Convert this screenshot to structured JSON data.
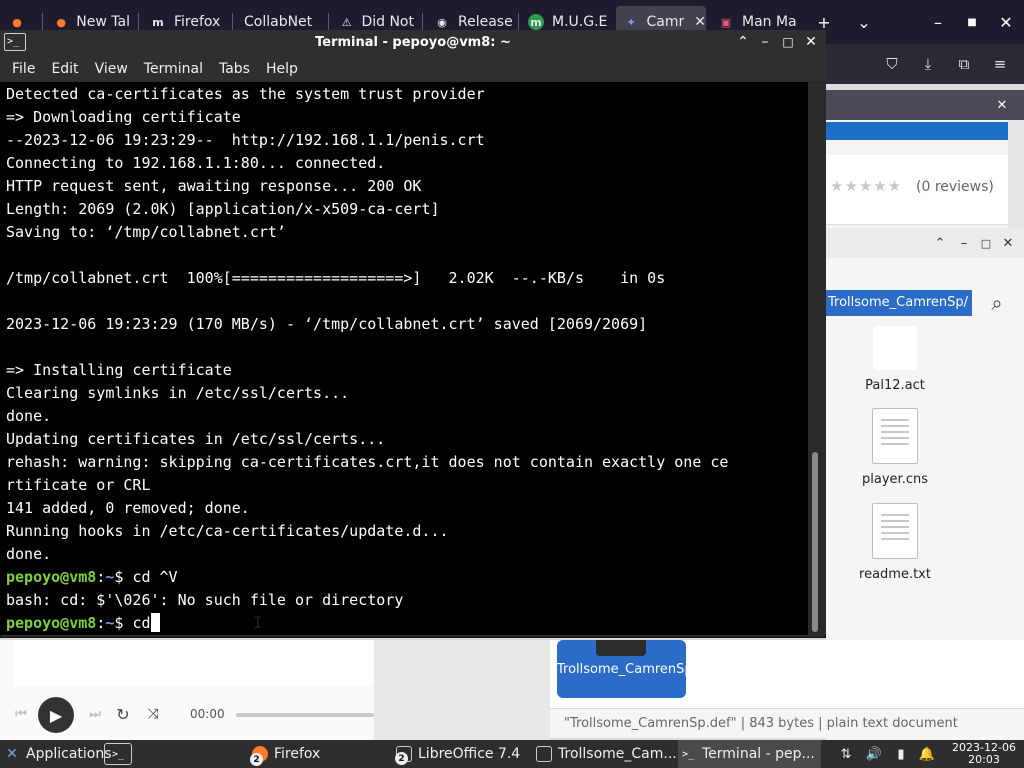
{
  "firefox": {
    "tabs": [
      {
        "label": "New Tal",
        "icon": "firefox-icon"
      },
      {
        "label": "Firefox",
        "icon": "m-icon"
      },
      {
        "label": "CollabNet",
        "icon": ""
      },
      {
        "label": "Did Not",
        "icon": "warning-icon"
      },
      {
        "label": "Release",
        "icon": "github-icon"
      },
      {
        "label": "M.U.G.E",
        "icon": "m-green-icon"
      },
      {
        "label": "Camr",
        "icon": "site-icon"
      },
      {
        "label": "Man Ma",
        "icon": "man-icon"
      }
    ],
    "reviews": "(0 reviews)"
  },
  "terminal": {
    "title": "Terminal - pepoyo@vm8: ~",
    "menu": [
      "File",
      "Edit",
      "View",
      "Terminal",
      "Tabs",
      "Help"
    ],
    "lines": [
      "Detected ca-certificates as the system trust provider",
      "=> Downloading certificate",
      "--2023-12-06 19:23:29--  http://192.168.1.1/penis.crt",
      "Connecting to 192.168.1.1:80... connected.",
      "HTTP request sent, awaiting response... 200 OK",
      "Length: 2069 (2.0K) [application/x-x509-ca-cert]",
      "Saving to: ‘/tmp/collabnet.crt’",
      "",
      "/tmp/collabnet.crt  100%[===================>]   2.02K  --.-KB/s    in 0s",
      "",
      "2023-12-06 19:23:29 (170 MB/s) - ‘/tmp/collabnet.crt’ saved [2069/2069]",
      "",
      "=> Installing certificate",
      "Clearing symlinks in /etc/ssl/certs...",
      "done.",
      "Updating certificates in /etc/ssl/certs...",
      "rehash: warning: skipping ca-certificates.crt,it does not contain exactly one ce",
      "rtificate or CRL",
      "141 added, 0 removed; done.",
      "Running hooks in /etc/ca-certificates/update.d...",
      "done."
    ],
    "prompt_user": "pepoyo@vm8",
    "prompt_sep": ":",
    "prompt_dir": "~",
    "prompt_end": "$ ",
    "cmd1": "cd ^V",
    "error_line": "bash: cd: $'\\026': No such file or directory",
    "cmd2": "cd"
  },
  "file_manager": {
    "path": "Trollsome_CamrenSp/",
    "items": [
      "Pal12.act",
      "player.cns",
      "readme.txt"
    ],
    "selected": "Trollsome_CamrenSp.def",
    "status": "\"Trollsome_CamrenSp.def\" | 843 bytes | plain text document"
  },
  "media": {
    "time": "00:00"
  },
  "panel": {
    "applications": "Applications",
    "tasks": [
      {
        "label": "Firefox",
        "badge": "2"
      },
      {
        "label": "LibreOffice 7.4",
        "badge": "2"
      },
      {
        "label": "Trollsome_Cam..."
      },
      {
        "label": "Terminal - pep..."
      }
    ],
    "date": "2023-12-06",
    "time": "20:03"
  }
}
